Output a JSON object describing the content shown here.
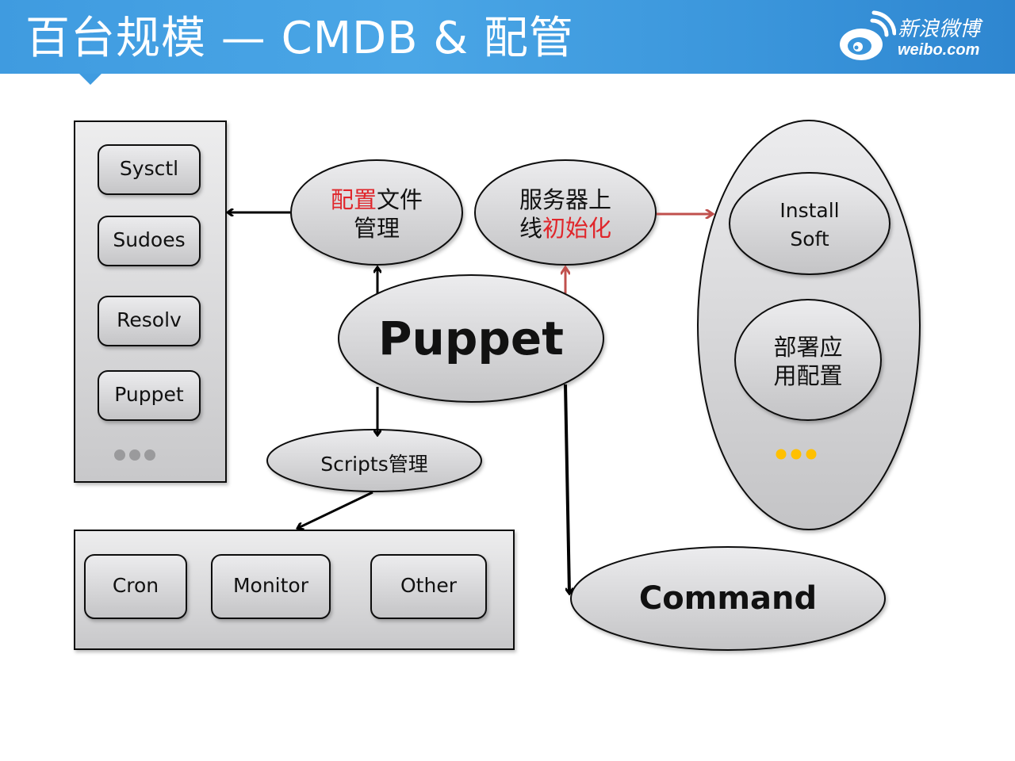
{
  "header": {
    "title": "百台规模 — CMDB & 配管",
    "logo": {
      "icon": "weibo-eye-icon",
      "name_cn": "新浪微博",
      "domain": "weibo.com"
    }
  },
  "colors": {
    "header_blue": "#3f9be0",
    "node_fill": "#d6d6d8",
    "red_text": "#e0262b",
    "red_arrow": "#c0504d",
    "ellipsis_gray": "#9a9a9c",
    "ellipsis_yellow": "#ffc000"
  },
  "diagram": {
    "config_modules": {
      "items": [
        "Sysctl",
        "Sudoes",
        "Resolv",
        "Puppet"
      ],
      "more": "…"
    },
    "config_file_mgmt": {
      "line1_red": "配置",
      "line1_black": "文件",
      "line2": "管理"
    },
    "server_init": {
      "line1": "服务器上",
      "line2_black": "线",
      "line2_red": "初始化"
    },
    "puppet": {
      "label": "Puppet"
    },
    "scripts_mgmt": {
      "label": "Scripts管理"
    },
    "script_modules": {
      "items": [
        "Cron",
        "Monitor",
        "Other"
      ]
    },
    "deploy_group": {
      "install_soft": {
        "line1": "Install",
        "line2": "Soft"
      },
      "deploy_app_config": {
        "line1": "部署应",
        "line2": "用配置"
      },
      "more": "…"
    },
    "command": {
      "label": "Command"
    },
    "edges": [
      {
        "from": "puppet",
        "to": "config_file_mgmt",
        "color": "black"
      },
      {
        "from": "config_file_mgmt",
        "to": "config_modules",
        "color": "black"
      },
      {
        "from": "puppet",
        "to": "server_init",
        "color": "red"
      },
      {
        "from": "server_init",
        "to": "deploy_group",
        "color": "red"
      },
      {
        "from": "puppet",
        "to": "scripts_mgmt",
        "color": "black"
      },
      {
        "from": "scripts_mgmt",
        "to": "script_modules",
        "color": "black"
      },
      {
        "from": "puppet",
        "to": "command",
        "color": "black"
      }
    ]
  }
}
